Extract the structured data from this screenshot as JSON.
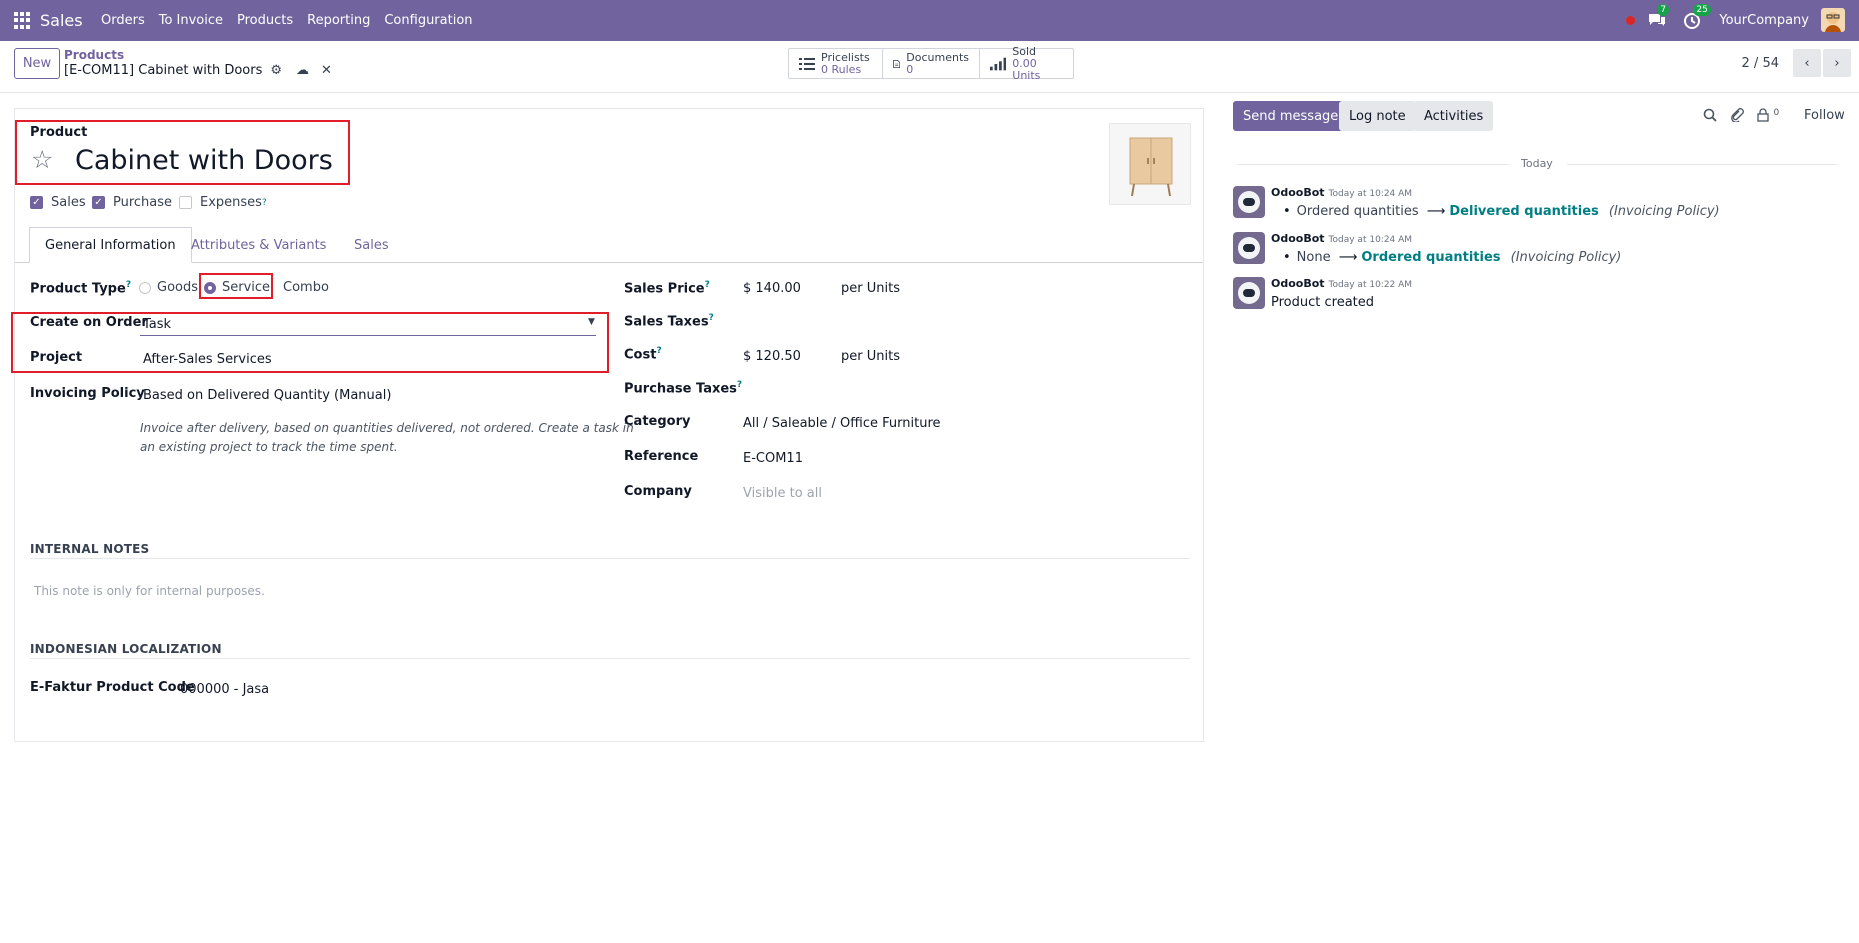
{
  "topbar": {
    "app_name": "Sales",
    "menu": [
      "Orders",
      "To Invoice",
      "Products",
      "Reporting",
      "Configuration"
    ],
    "chat_count": "7",
    "activity_count": "25",
    "company": "YourCompany"
  },
  "control": {
    "new_label": "New",
    "breadcrumb_parent": "Products",
    "breadcrumb_current": "[E-COM11] Cabinet with Doors",
    "smart_buttons": [
      {
        "icon": "list-icon",
        "title": "Pricelists",
        "value": "0 Rules"
      },
      {
        "icon": "document-icon",
        "title": "Documents",
        "value": "0"
      },
      {
        "icon": "bar-chart-icon",
        "title": "Sold",
        "value": "0.00 Units"
      }
    ],
    "pager": "2 / 54"
  },
  "form": {
    "product_label": "Product",
    "product_name": "Cabinet with Doors",
    "checkboxes": [
      {
        "label": "Sales",
        "checked": true
      },
      {
        "label": "Purchase",
        "checked": true
      },
      {
        "label": "Expenses",
        "checked": false
      }
    ],
    "tabs": [
      "General Information",
      "Attributes & Variants",
      "Sales"
    ],
    "left": {
      "product_type_label": "Product Type",
      "product_type_options": [
        "Goods",
        "Service",
        "Combo"
      ],
      "product_type_selected": "Service",
      "create_on_order_label": "Create on Order",
      "create_on_order_value": "Task",
      "project_label": "Project",
      "project_value": "After-Sales Services",
      "invoicing_policy_label": "Invoicing Policy",
      "invoicing_policy_value": "Based on Delivered Quantity (Manual)",
      "help_line1": "Invoice after delivery, based on quantities delivered, not ordered. Create a task in",
      "help_line2": "an existing project to track the time spent."
    },
    "right": {
      "sales_price_label": "Sales Price",
      "sales_price_value": "$ 140.00",
      "sales_price_unit": "per  Units",
      "sales_taxes_label": "Sales Taxes",
      "cost_label": "Cost",
      "cost_value": "$ 120.50",
      "cost_unit": "per Units",
      "purchase_taxes_label": "Purchase Taxes",
      "category_label": "Category",
      "category_value": "All / Saleable / Office Furniture",
      "reference_label": "Reference",
      "reference_value": "E-COM11",
      "company_label": "Company",
      "company_placeholder": "Visible to all"
    },
    "internal_notes_title": "INTERNAL NOTES",
    "internal_notes_placeholder": "This note is only for internal purposes.",
    "indonesian_title": "INDONESIAN LOCALIZATION",
    "efaktur_label": "E-Faktur Product Code",
    "efaktur_value": "000000 - Jasa"
  },
  "chatter": {
    "send_message": "Send message",
    "log_note": "Log note",
    "activities": "Activities",
    "followers_count": "0",
    "follow": "Follow",
    "today": "Today",
    "messages": [
      {
        "author": "OdooBot",
        "time": "Today at 10:24 AM",
        "old": "Ordered quantities",
        "new": "Delivered quantities",
        "field": "(Invoicing Policy)"
      },
      {
        "author": "OdooBot",
        "time": "Today at 10:24 AM",
        "old": "None",
        "new": "Ordered quantities",
        "field": "(Invoicing Policy)"
      },
      {
        "author": "OdooBot",
        "time": "Today at 10:22 AM",
        "text": "Product created"
      }
    ]
  },
  "colors": {
    "brand": "#71639e",
    "highlight": "#e11d2a",
    "link": "#017e84"
  }
}
